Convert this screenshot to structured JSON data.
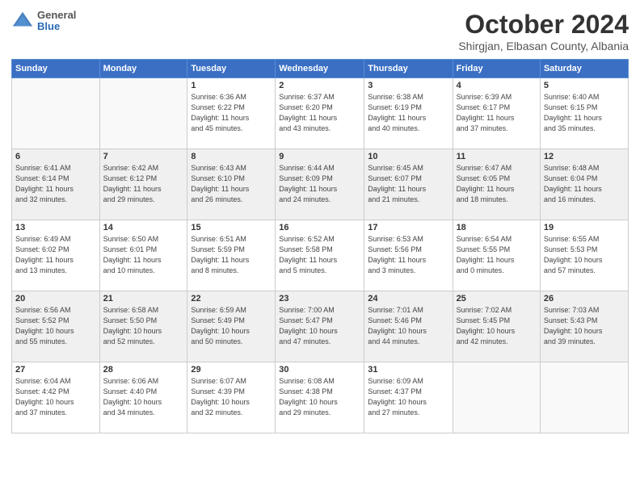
{
  "header": {
    "logo": {
      "general": "General",
      "blue": "Blue"
    },
    "title": "October 2024",
    "subtitle": "Shirgjan, Elbasan County, Albania"
  },
  "days_of_week": [
    "Sunday",
    "Monday",
    "Tuesday",
    "Wednesday",
    "Thursday",
    "Friday",
    "Saturday"
  ],
  "weeks": [
    {
      "shaded": false,
      "days": [
        {
          "num": "",
          "info": ""
        },
        {
          "num": "",
          "info": ""
        },
        {
          "num": "1",
          "info": "Sunrise: 6:36 AM\nSunset: 6:22 PM\nDaylight: 11 hours\nand 45 minutes."
        },
        {
          "num": "2",
          "info": "Sunrise: 6:37 AM\nSunset: 6:20 PM\nDaylight: 11 hours\nand 43 minutes."
        },
        {
          "num": "3",
          "info": "Sunrise: 6:38 AM\nSunset: 6:19 PM\nDaylight: 11 hours\nand 40 minutes."
        },
        {
          "num": "4",
          "info": "Sunrise: 6:39 AM\nSunset: 6:17 PM\nDaylight: 11 hours\nand 37 minutes."
        },
        {
          "num": "5",
          "info": "Sunrise: 6:40 AM\nSunset: 6:15 PM\nDaylight: 11 hours\nand 35 minutes."
        }
      ]
    },
    {
      "shaded": true,
      "days": [
        {
          "num": "6",
          "info": "Sunrise: 6:41 AM\nSunset: 6:14 PM\nDaylight: 11 hours\nand 32 minutes."
        },
        {
          "num": "7",
          "info": "Sunrise: 6:42 AM\nSunset: 6:12 PM\nDaylight: 11 hours\nand 29 minutes."
        },
        {
          "num": "8",
          "info": "Sunrise: 6:43 AM\nSunset: 6:10 PM\nDaylight: 11 hours\nand 26 minutes."
        },
        {
          "num": "9",
          "info": "Sunrise: 6:44 AM\nSunset: 6:09 PM\nDaylight: 11 hours\nand 24 minutes."
        },
        {
          "num": "10",
          "info": "Sunrise: 6:45 AM\nSunset: 6:07 PM\nDaylight: 11 hours\nand 21 minutes."
        },
        {
          "num": "11",
          "info": "Sunrise: 6:47 AM\nSunset: 6:05 PM\nDaylight: 11 hours\nand 18 minutes."
        },
        {
          "num": "12",
          "info": "Sunrise: 6:48 AM\nSunset: 6:04 PM\nDaylight: 11 hours\nand 16 minutes."
        }
      ]
    },
    {
      "shaded": false,
      "days": [
        {
          "num": "13",
          "info": "Sunrise: 6:49 AM\nSunset: 6:02 PM\nDaylight: 11 hours\nand 13 minutes."
        },
        {
          "num": "14",
          "info": "Sunrise: 6:50 AM\nSunset: 6:01 PM\nDaylight: 11 hours\nand 10 minutes."
        },
        {
          "num": "15",
          "info": "Sunrise: 6:51 AM\nSunset: 5:59 PM\nDaylight: 11 hours\nand 8 minutes."
        },
        {
          "num": "16",
          "info": "Sunrise: 6:52 AM\nSunset: 5:58 PM\nDaylight: 11 hours\nand 5 minutes."
        },
        {
          "num": "17",
          "info": "Sunrise: 6:53 AM\nSunset: 5:56 PM\nDaylight: 11 hours\nand 3 minutes."
        },
        {
          "num": "18",
          "info": "Sunrise: 6:54 AM\nSunset: 5:55 PM\nDaylight: 11 hours\nand 0 minutes."
        },
        {
          "num": "19",
          "info": "Sunrise: 6:55 AM\nSunset: 5:53 PM\nDaylight: 10 hours\nand 57 minutes."
        }
      ]
    },
    {
      "shaded": true,
      "days": [
        {
          "num": "20",
          "info": "Sunrise: 6:56 AM\nSunset: 5:52 PM\nDaylight: 10 hours\nand 55 minutes."
        },
        {
          "num": "21",
          "info": "Sunrise: 6:58 AM\nSunset: 5:50 PM\nDaylight: 10 hours\nand 52 minutes."
        },
        {
          "num": "22",
          "info": "Sunrise: 6:59 AM\nSunset: 5:49 PM\nDaylight: 10 hours\nand 50 minutes."
        },
        {
          "num": "23",
          "info": "Sunrise: 7:00 AM\nSunset: 5:47 PM\nDaylight: 10 hours\nand 47 minutes."
        },
        {
          "num": "24",
          "info": "Sunrise: 7:01 AM\nSunset: 5:46 PM\nDaylight: 10 hours\nand 44 minutes."
        },
        {
          "num": "25",
          "info": "Sunrise: 7:02 AM\nSunset: 5:45 PM\nDaylight: 10 hours\nand 42 minutes."
        },
        {
          "num": "26",
          "info": "Sunrise: 7:03 AM\nSunset: 5:43 PM\nDaylight: 10 hours\nand 39 minutes."
        }
      ]
    },
    {
      "shaded": false,
      "days": [
        {
          "num": "27",
          "info": "Sunrise: 6:04 AM\nSunset: 4:42 PM\nDaylight: 10 hours\nand 37 minutes."
        },
        {
          "num": "28",
          "info": "Sunrise: 6:06 AM\nSunset: 4:40 PM\nDaylight: 10 hours\nand 34 minutes."
        },
        {
          "num": "29",
          "info": "Sunrise: 6:07 AM\nSunset: 4:39 PM\nDaylight: 10 hours\nand 32 minutes."
        },
        {
          "num": "30",
          "info": "Sunrise: 6:08 AM\nSunset: 4:38 PM\nDaylight: 10 hours\nand 29 minutes."
        },
        {
          "num": "31",
          "info": "Sunrise: 6:09 AM\nSunset: 4:37 PM\nDaylight: 10 hours\nand 27 minutes."
        },
        {
          "num": "",
          "info": ""
        },
        {
          "num": "",
          "info": ""
        }
      ]
    }
  ]
}
